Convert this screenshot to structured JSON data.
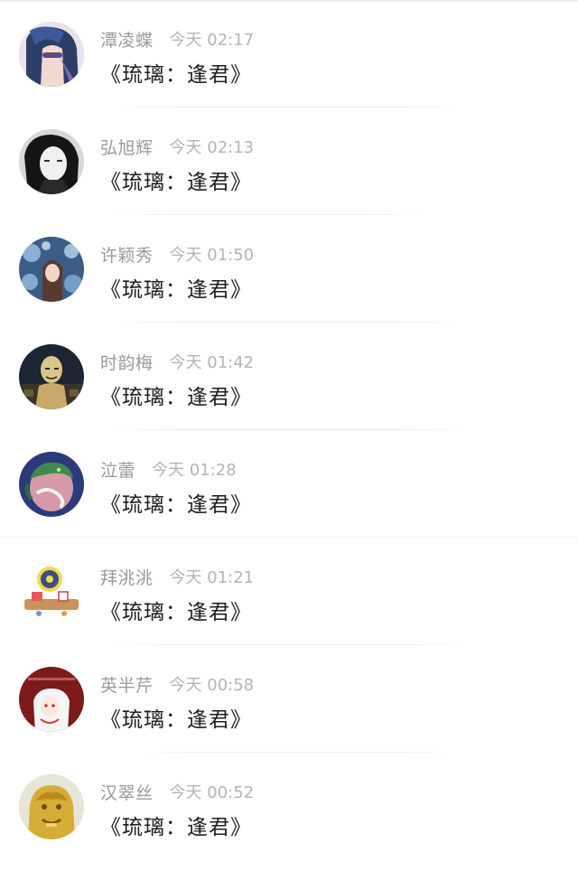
{
  "comments": [
    {
      "name": "潭凌蝶",
      "time": "今天 02:17",
      "text": "《琉璃：逢君》",
      "avatar_icon": "anime-girl-glasses-avatar"
    },
    {
      "name": "弘旭辉",
      "time": "今天 02:13",
      "text": "《琉璃：逢君》",
      "avatar_icon": "bw-girl-portrait-avatar"
    },
    {
      "name": "许颖秀",
      "time": "今天 01:50",
      "text": "《琉璃：逢君》",
      "avatar_icon": "girl-bubbles-avatar"
    },
    {
      "name": "时韵梅",
      "time": "今天 01:42",
      "text": "《琉璃：逢君》",
      "avatar_icon": "masked-man-avatar"
    },
    {
      "name": "泣蕾",
      "time": "今天 01:28",
      "text": "《琉璃：逢君》",
      "avatar_icon": "dragon-egg-avatar"
    },
    {
      "name": "拜洮洮",
      "time": "今天 01:21",
      "text": "《琉璃：逢君》",
      "avatar_icon": "cartoon-desk-avatar"
    },
    {
      "name": "英半芹",
      "time": "今天 00:58",
      "text": "《琉璃：逢君》",
      "avatar_icon": "red-anime-character-avatar"
    },
    {
      "name": "汉翠丝",
      "time": "今天 00:52",
      "text": "《琉璃：逢君》",
      "avatar_icon": "golden-lion-statue-avatar"
    }
  ]
}
